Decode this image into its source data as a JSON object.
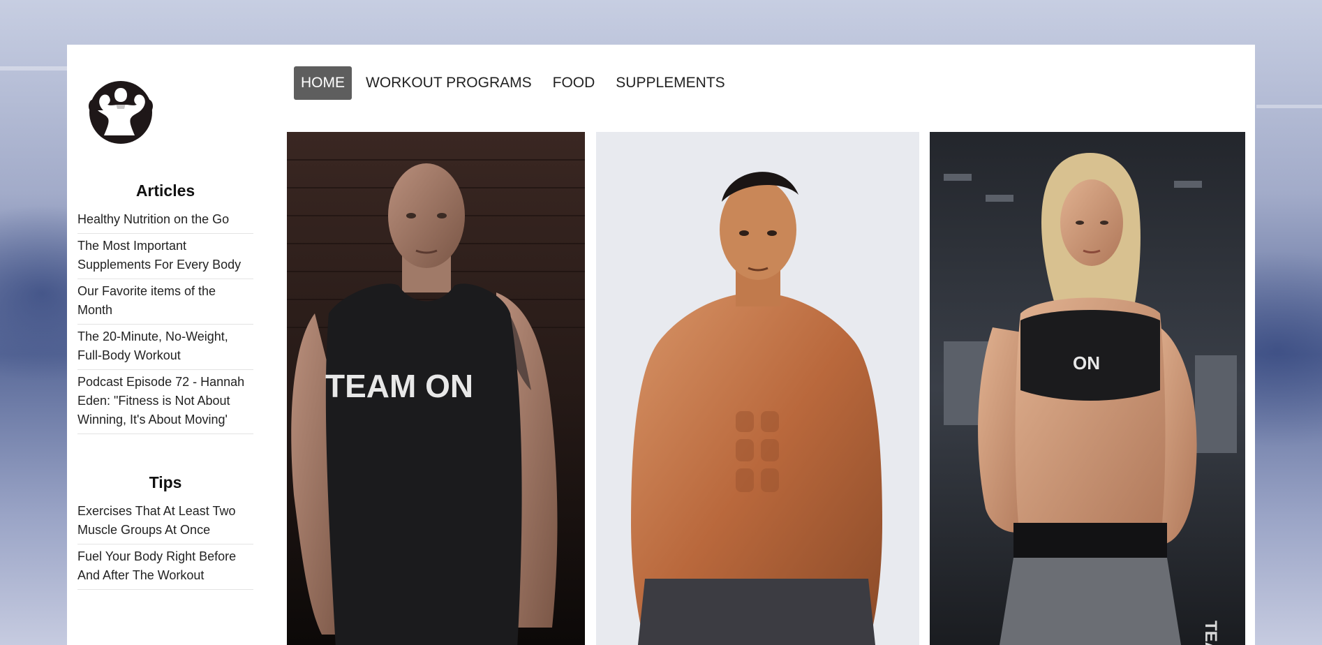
{
  "nav": {
    "items": [
      {
        "label": "HOME",
        "active": true
      },
      {
        "label": "WORKOUT PROGRAMS",
        "active": false
      },
      {
        "label": "FOOD",
        "active": false
      },
      {
        "label": "SUPPLEMENTS",
        "active": false
      }
    ]
  },
  "sidebar": {
    "articles_heading": "Articles",
    "articles": [
      "Healthy Nutrition on the Go",
      "The Most Important Supplements For Every Body",
      "Our Favorite items of the Month",
      "The 20-Minute, No-Weight, Full-Body Workout",
      "Podcast Episode 72 - Hannah Eden: \"Fitness is Not About Winning, It's About Moving'"
    ],
    "tips_heading": "Tips",
    "tips": [
      "Exercises That At Least Two Muscle Groups At Once",
      "Fuel Your Body Right Before And After The Workout"
    ]
  },
  "photos": {
    "shirt_text_1": "TEAM ON",
    "shirt_text_3": "ON",
    "legging_text": "TEAM"
  },
  "colors": {
    "nav_active_bg": "#5e5e5e",
    "panel_bg": "#ffffff",
    "background": "#5a6a99"
  },
  "icons": {
    "logo": "bodybuilder-logo-icon"
  }
}
